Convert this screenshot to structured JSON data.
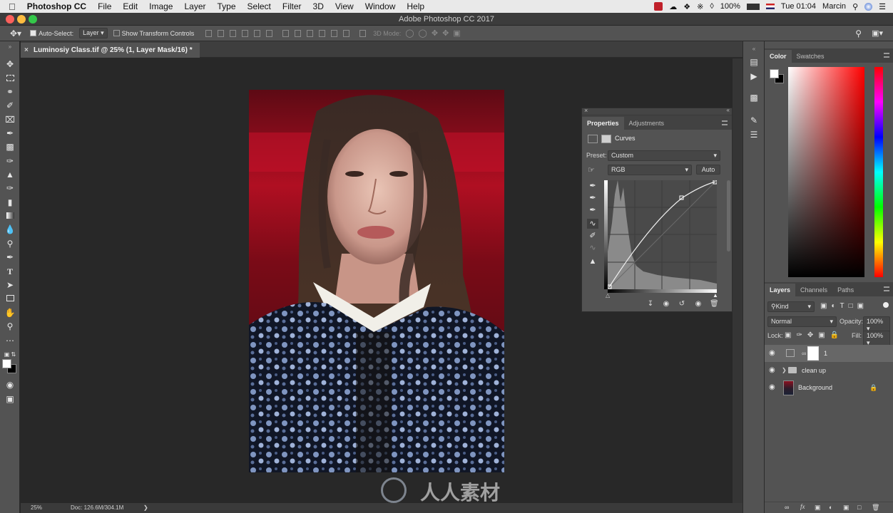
{
  "menubar": {
    "app_name": "Photoshop CC",
    "items": [
      "File",
      "Edit",
      "Image",
      "Layer",
      "Type",
      "Select",
      "Filter",
      "3D",
      "View",
      "Window",
      "Help"
    ],
    "battery": "100%",
    "clock": "Tue 01:04",
    "user": "Marcin"
  },
  "titlebar": {
    "title": "Adobe Photoshop CC 2017"
  },
  "options": {
    "auto_select_label": "Auto-Select:",
    "auto_select_value": "Layer",
    "show_transform_label": "Show Transform Controls",
    "mode_3d_label": "3D Mode:"
  },
  "document": {
    "tab_title": "Luminosiy Class.tif @ 25% (1, Layer Mask/16) *",
    "zoom": "25%",
    "doc_size": "Doc: 126.6M/304.1M"
  },
  "color_panel": {
    "tabs": [
      "Color",
      "Swatches"
    ],
    "hue_color": "#ff0000"
  },
  "properties_panel": {
    "tabs": [
      "Properties",
      "Adjustments"
    ],
    "adjustment_title": "Curves",
    "preset_label": "Preset:",
    "preset_value": "Custom",
    "channel_value": "RGB",
    "auto_button": "Auto"
  },
  "layers_panel": {
    "tabs": [
      "Layers",
      "Channels",
      "Paths"
    ],
    "filter_kind": "Kind",
    "blend_mode": "Normal",
    "opacity_label": "Opacity:",
    "opacity_value": "100%",
    "lock_label": "Lock:",
    "fill_label": "Fill:",
    "fill_value": "100%",
    "layers": [
      {
        "name": "1",
        "type": "curves-adjustment",
        "visible": true,
        "selected": true
      },
      {
        "name": "clean up",
        "type": "group",
        "visible": true,
        "selected": false
      },
      {
        "name": "Background",
        "type": "image",
        "visible": true,
        "selected": false,
        "locked": true
      }
    ]
  },
  "watermark": {
    "text": "人人素材"
  }
}
